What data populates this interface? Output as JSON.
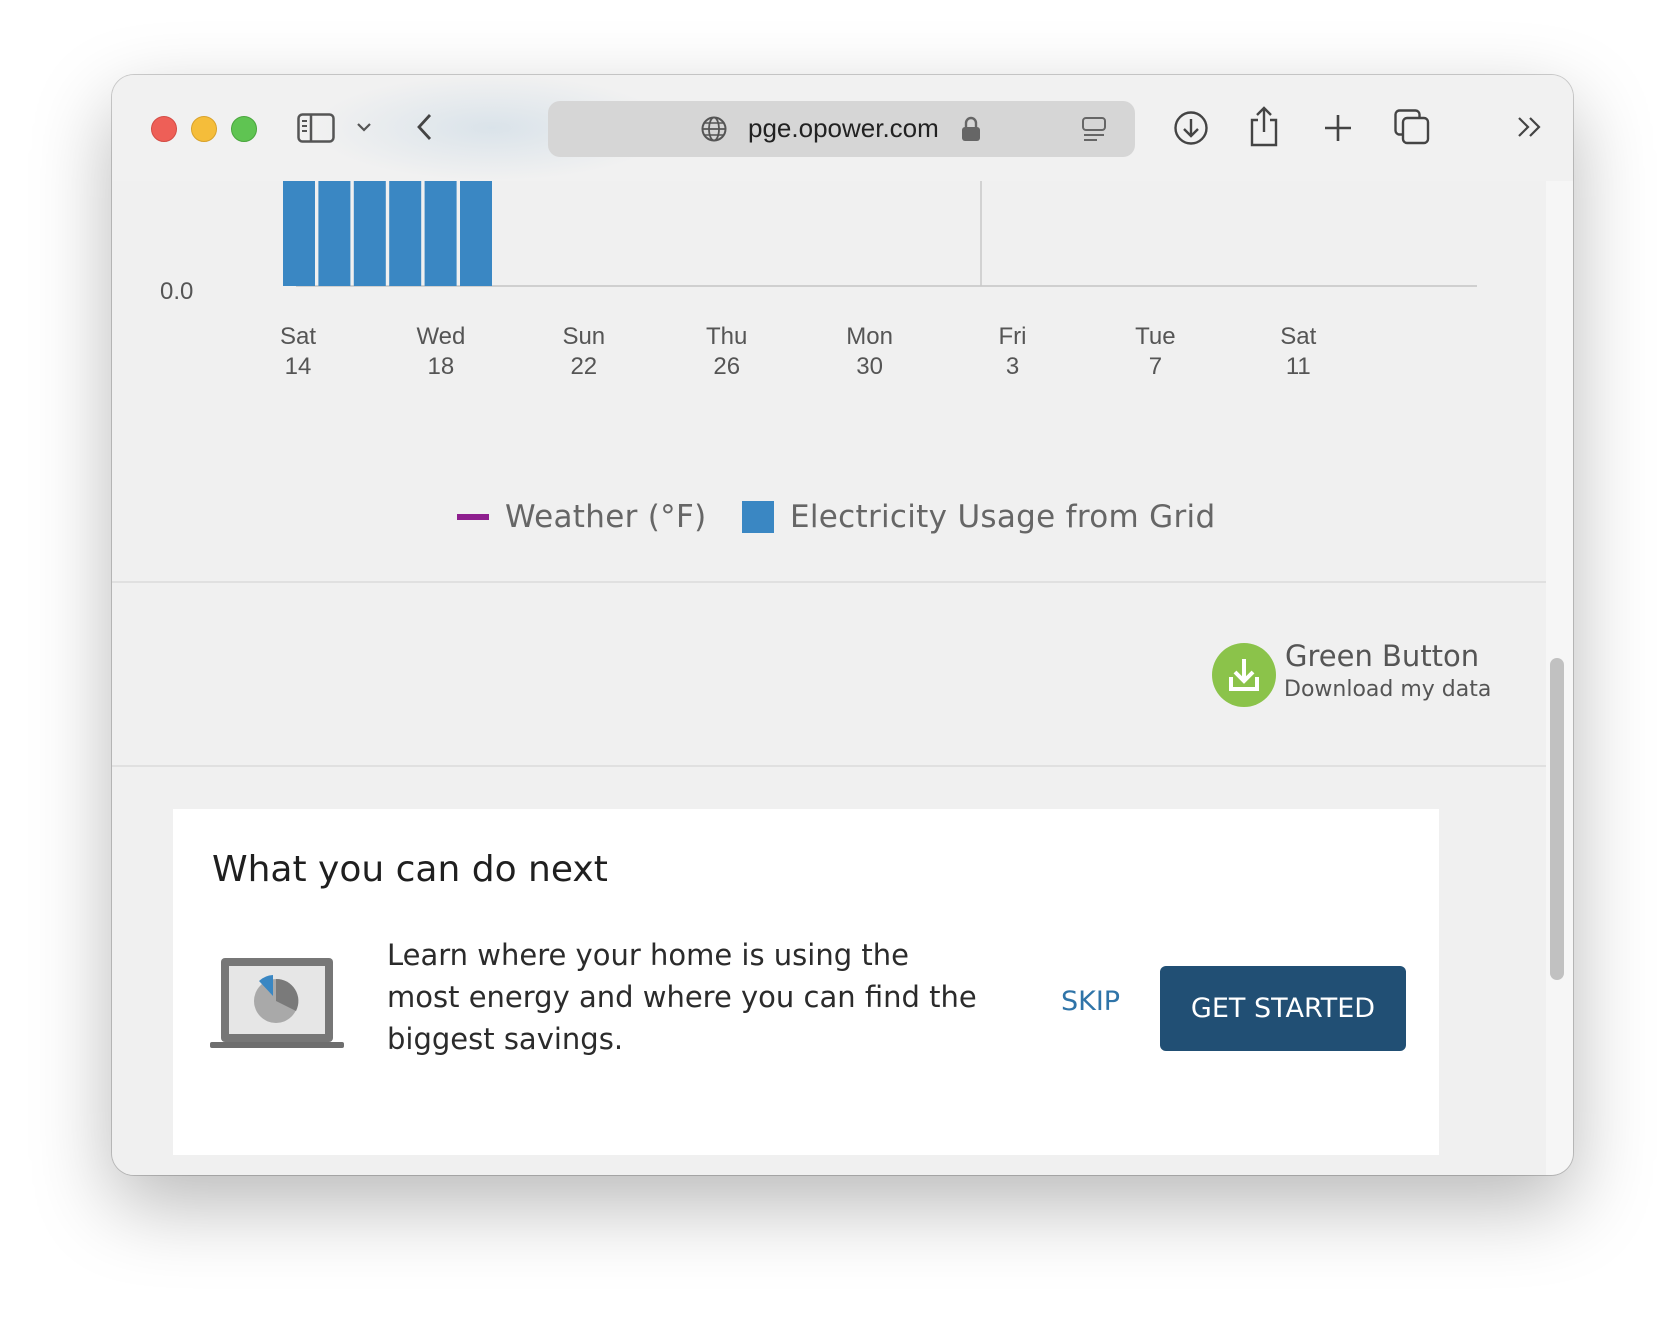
{
  "browser": {
    "url": "pge.opower.com"
  },
  "chart_data": {
    "type": "bar",
    "y_ticks": [
      "0.0"
    ],
    "x_ticks": [
      {
        "day": "Sat",
        "date": "14"
      },
      {
        "day": "Wed",
        "date": "18"
      },
      {
        "day": "Sun",
        "date": "22"
      },
      {
        "day": "Thu",
        "date": "26"
      },
      {
        "day": "Mon",
        "date": "30"
      },
      {
        "day": "Fri",
        "date": "3"
      },
      {
        "day": "Tue",
        "date": "7"
      },
      {
        "day": "Sat",
        "date": "11"
      }
    ],
    "bar_color": "#3a87c3",
    "visible_bar_count": 6,
    "legend": [
      {
        "label": "Weather (°F)",
        "color": "#8e1f8e",
        "marker": "line"
      },
      {
        "label": "Electricity Usage from Grid",
        "color": "#3a87c3",
        "marker": "square"
      }
    ]
  },
  "green_button": {
    "title": "Green Button",
    "subtitle": "Download my data",
    "color": "#8bc34a"
  },
  "next_card": {
    "title": "What you can do next",
    "text": "Learn where your home is using the most energy and where you can find the biggest savings.",
    "skip_label": "SKIP",
    "cta_label": "GET STARTED",
    "cta_color": "#214f74"
  }
}
